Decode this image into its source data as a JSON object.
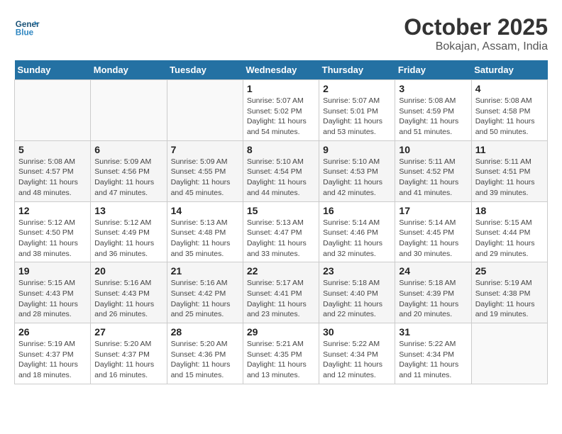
{
  "header": {
    "logo_line1": "General",
    "logo_line2": "Blue",
    "title": "October 2025",
    "subtitle": "Bokajan, Assam, India"
  },
  "days_of_week": [
    "Sunday",
    "Monday",
    "Tuesday",
    "Wednesday",
    "Thursday",
    "Friday",
    "Saturday"
  ],
  "weeks": [
    [
      {
        "day": "",
        "info": ""
      },
      {
        "day": "",
        "info": ""
      },
      {
        "day": "",
        "info": ""
      },
      {
        "day": "1",
        "info": "Sunrise: 5:07 AM\nSunset: 5:02 PM\nDaylight: 11 hours and 54 minutes."
      },
      {
        "day": "2",
        "info": "Sunrise: 5:07 AM\nSunset: 5:01 PM\nDaylight: 11 hours and 53 minutes."
      },
      {
        "day": "3",
        "info": "Sunrise: 5:08 AM\nSunset: 4:59 PM\nDaylight: 11 hours and 51 minutes."
      },
      {
        "day": "4",
        "info": "Sunrise: 5:08 AM\nSunset: 4:58 PM\nDaylight: 11 hours and 50 minutes."
      }
    ],
    [
      {
        "day": "5",
        "info": "Sunrise: 5:08 AM\nSunset: 4:57 PM\nDaylight: 11 hours and 48 minutes."
      },
      {
        "day": "6",
        "info": "Sunrise: 5:09 AM\nSunset: 4:56 PM\nDaylight: 11 hours and 47 minutes."
      },
      {
        "day": "7",
        "info": "Sunrise: 5:09 AM\nSunset: 4:55 PM\nDaylight: 11 hours and 45 minutes."
      },
      {
        "day": "8",
        "info": "Sunrise: 5:10 AM\nSunset: 4:54 PM\nDaylight: 11 hours and 44 minutes."
      },
      {
        "day": "9",
        "info": "Sunrise: 5:10 AM\nSunset: 4:53 PM\nDaylight: 11 hours and 42 minutes."
      },
      {
        "day": "10",
        "info": "Sunrise: 5:11 AM\nSunset: 4:52 PM\nDaylight: 11 hours and 41 minutes."
      },
      {
        "day": "11",
        "info": "Sunrise: 5:11 AM\nSunset: 4:51 PM\nDaylight: 11 hours and 39 minutes."
      }
    ],
    [
      {
        "day": "12",
        "info": "Sunrise: 5:12 AM\nSunset: 4:50 PM\nDaylight: 11 hours and 38 minutes."
      },
      {
        "day": "13",
        "info": "Sunrise: 5:12 AM\nSunset: 4:49 PM\nDaylight: 11 hours and 36 minutes."
      },
      {
        "day": "14",
        "info": "Sunrise: 5:13 AM\nSunset: 4:48 PM\nDaylight: 11 hours and 35 minutes."
      },
      {
        "day": "15",
        "info": "Sunrise: 5:13 AM\nSunset: 4:47 PM\nDaylight: 11 hours and 33 minutes."
      },
      {
        "day": "16",
        "info": "Sunrise: 5:14 AM\nSunset: 4:46 PM\nDaylight: 11 hours and 32 minutes."
      },
      {
        "day": "17",
        "info": "Sunrise: 5:14 AM\nSunset: 4:45 PM\nDaylight: 11 hours and 30 minutes."
      },
      {
        "day": "18",
        "info": "Sunrise: 5:15 AM\nSunset: 4:44 PM\nDaylight: 11 hours and 29 minutes."
      }
    ],
    [
      {
        "day": "19",
        "info": "Sunrise: 5:15 AM\nSunset: 4:43 PM\nDaylight: 11 hours and 28 minutes."
      },
      {
        "day": "20",
        "info": "Sunrise: 5:16 AM\nSunset: 4:43 PM\nDaylight: 11 hours and 26 minutes."
      },
      {
        "day": "21",
        "info": "Sunrise: 5:16 AM\nSunset: 4:42 PM\nDaylight: 11 hours and 25 minutes."
      },
      {
        "day": "22",
        "info": "Sunrise: 5:17 AM\nSunset: 4:41 PM\nDaylight: 11 hours and 23 minutes."
      },
      {
        "day": "23",
        "info": "Sunrise: 5:18 AM\nSunset: 4:40 PM\nDaylight: 11 hours and 22 minutes."
      },
      {
        "day": "24",
        "info": "Sunrise: 5:18 AM\nSunset: 4:39 PM\nDaylight: 11 hours and 20 minutes."
      },
      {
        "day": "25",
        "info": "Sunrise: 5:19 AM\nSunset: 4:38 PM\nDaylight: 11 hours and 19 minutes."
      }
    ],
    [
      {
        "day": "26",
        "info": "Sunrise: 5:19 AM\nSunset: 4:37 PM\nDaylight: 11 hours and 18 minutes."
      },
      {
        "day": "27",
        "info": "Sunrise: 5:20 AM\nSunset: 4:37 PM\nDaylight: 11 hours and 16 minutes."
      },
      {
        "day": "28",
        "info": "Sunrise: 5:20 AM\nSunset: 4:36 PM\nDaylight: 11 hours and 15 minutes."
      },
      {
        "day": "29",
        "info": "Sunrise: 5:21 AM\nSunset: 4:35 PM\nDaylight: 11 hours and 13 minutes."
      },
      {
        "day": "30",
        "info": "Sunrise: 5:22 AM\nSunset: 4:34 PM\nDaylight: 11 hours and 12 minutes."
      },
      {
        "day": "31",
        "info": "Sunrise: 5:22 AM\nSunset: 4:34 PM\nDaylight: 11 hours and 11 minutes."
      },
      {
        "day": "",
        "info": ""
      }
    ]
  ]
}
